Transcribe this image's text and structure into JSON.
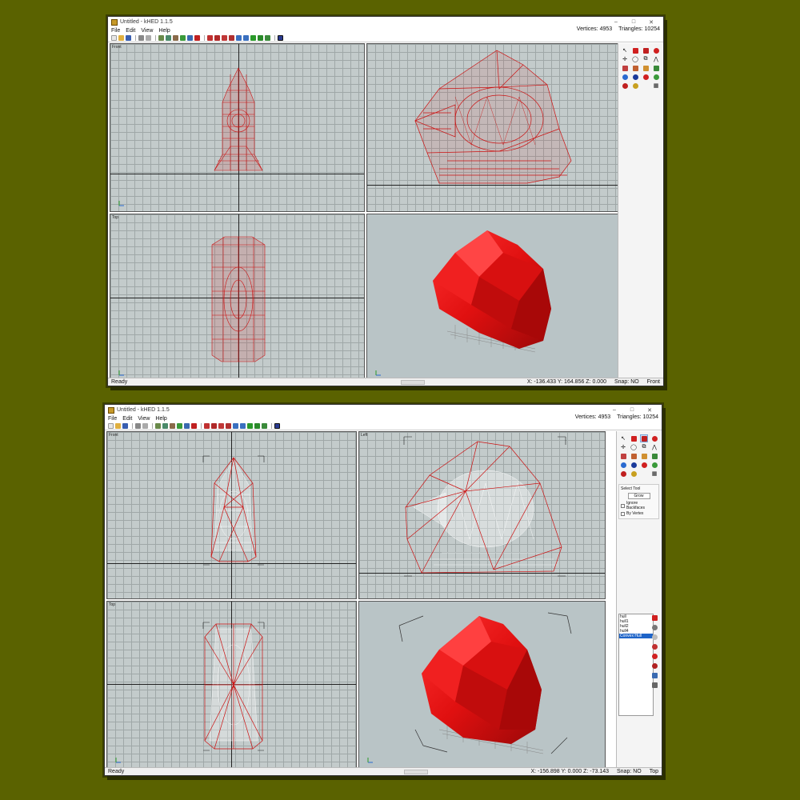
{
  "screenshots": [
    {
      "title": "Untitled - kHED 1.1.5",
      "menus": [
        "File",
        "Edit",
        "View",
        "Help"
      ],
      "vertices": "Vertices: 4953",
      "triangles": "Triangles: 10254",
      "viewports": {
        "top_left": "Front",
        "top_right": "",
        "bottom_left": "Top",
        "bottom_right": ""
      },
      "status": {
        "left": "Ready",
        "coords": "X: -136.433 Y: 164.856 Z: 0.000",
        "snap": "Snap: NO",
        "view": "Front"
      }
    },
    {
      "title": "Untitled - kHED 1.1.5",
      "menus": [
        "File",
        "Edit",
        "View",
        "Help"
      ],
      "vertices": "Vertices: 4953",
      "triangles": "Triangles: 10254",
      "viewports": {
        "top_left": "Front",
        "top_right": "Left",
        "bottom_left": "Top",
        "bottom_right": ""
      },
      "select_tool": {
        "title": "Select Tool",
        "grow": "Grow",
        "ignore_backfaces": "Ignore Backfaces",
        "by_vertex": "By Vertex"
      },
      "object_list": [
        "hull",
        "hull1",
        "hull2",
        "hull4",
        "Convex Hull"
      ],
      "status": {
        "left": "Ready",
        "coords": "X: -156.898 Y: 0.000 Z: -73.143",
        "snap": "Snap: NO",
        "view": "Top"
      }
    }
  ],
  "colors": {
    "background": "#5a6200",
    "mesh_red": "#cc1111",
    "hull_red": "#e01010",
    "viewport": "#c3cbcb"
  }
}
